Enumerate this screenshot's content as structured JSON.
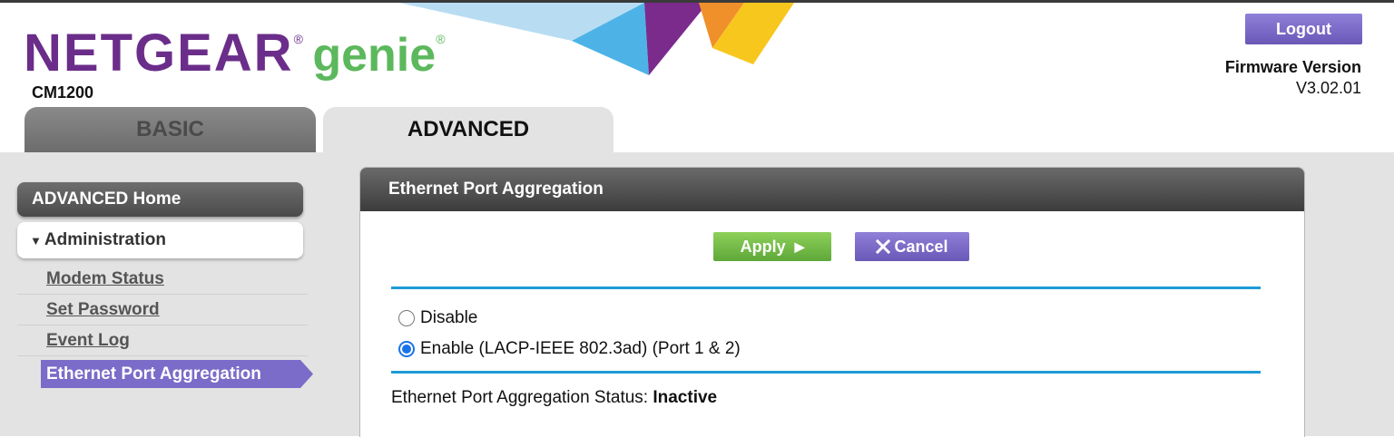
{
  "header": {
    "logo_brand": "NETGEAR",
    "logo_product": "genie",
    "model": "CM1200",
    "logout_label": "Logout",
    "firmware_label": "Firmware Version",
    "firmware_value": "V3.02.01"
  },
  "tabs": [
    {
      "label": "BASIC",
      "active": false
    },
    {
      "label": "ADVANCED",
      "active": true
    }
  ],
  "sidebar": {
    "home_label": "ADVANCED Home",
    "section_label": "Administration",
    "items": [
      {
        "label": "Modem Status"
      },
      {
        "label": "Set Password"
      },
      {
        "label": "Event Log"
      },
      {
        "label": "Ethernet Port Aggregation",
        "active": true
      }
    ]
  },
  "panel": {
    "title": "Ethernet Port Aggregation",
    "apply_label": "Apply",
    "cancel_label": "Cancel",
    "options": [
      {
        "label": "Disable",
        "selected": false
      },
      {
        "label": "Enable (LACP-IEEE 802.3ad) (Port 1 & 2)",
        "selected": true
      }
    ],
    "status_label": "Ethernet Port Aggregation Status:",
    "status_value": "Inactive"
  },
  "colors": {
    "brand_purple": "#6b2d8a",
    "brand_green": "#5cb85c",
    "accent_purple": "#7a6cc8",
    "apply_green": "#6bb845",
    "divider_blue": "#1e9ad6"
  }
}
